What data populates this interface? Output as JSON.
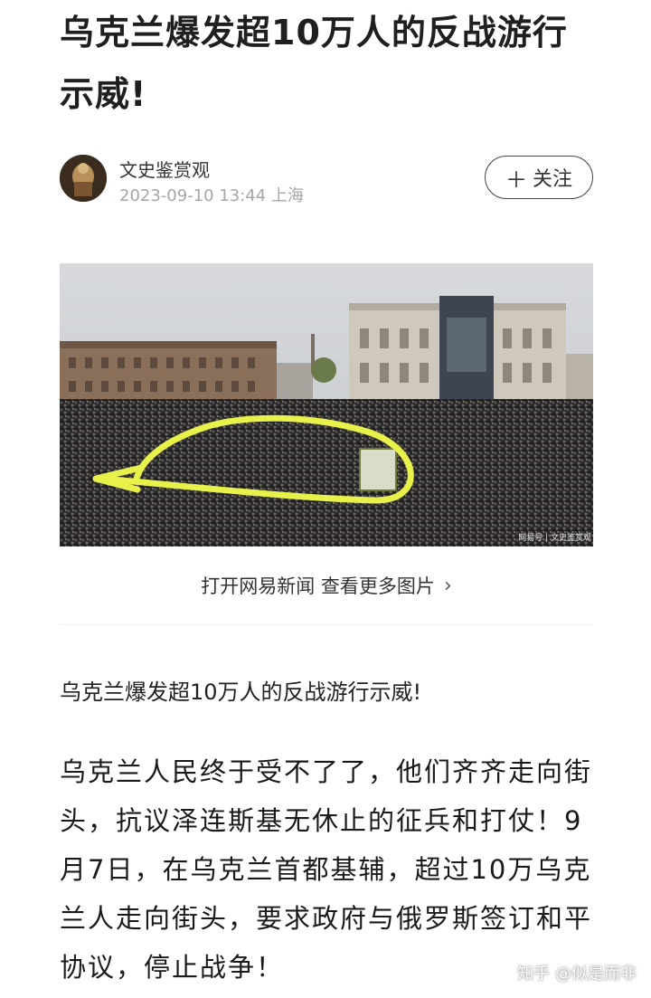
{
  "article": {
    "title": "乌克兰爆发超10万人的反战游行示威!",
    "author": {
      "name": "文史鉴赏观",
      "meta": "2023-09-10 13:44 上海"
    },
    "follow_label": "关注",
    "follow_icon": "plus-icon",
    "photo": {
      "watermark_text": "网易号 | 文史鉴赏观"
    },
    "open_link_label": "打开网易新闻 查看更多图片",
    "lead": "乌克兰爆发超10万人的反战游行示威!",
    "body": "乌克兰人民终于受不了了，他们齐齐走向街头，抗议泽连斯基无休止的征兵和打仗！9月7日，在乌克兰首都基辅，超过10万乌克兰人走向街头，要求政府与俄罗斯签订和平协议，停止战争！"
  },
  "watermark": "知乎 @似是而非",
  "colors": {
    "highlight_circle": "#e8f04a",
    "meta_gray": "#a6a6a6"
  }
}
